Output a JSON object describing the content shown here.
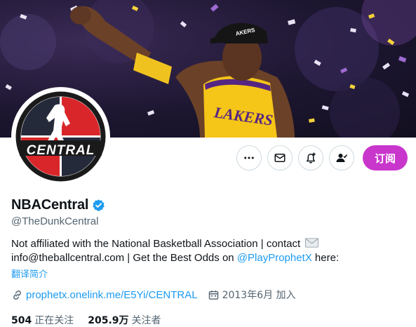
{
  "profile": {
    "display_name": "NBACentral",
    "handle": "@TheDunkCentral",
    "bio_line1": "Not affiliated with the National Basketball Association | contact",
    "bio_line2_pre": "info@theballcentral.com | Get the Best Odds on ",
    "bio_mention": "@PlayProphetX",
    "bio_line2_post": " here:",
    "translate_label": "翻译简介",
    "website": "prophetx.onelink.me/E5Yi/CENTRAL",
    "joined": "2013年6月 加入",
    "avatar_text": "CENTRAL"
  },
  "stats": {
    "following_count": "504",
    "following_label": "正在关注",
    "followers_count": "205.9万",
    "followers_label": "关注者"
  },
  "actions": {
    "subscribe_label": "订阅"
  },
  "icons": {
    "more": "more-icon",
    "message": "mail-icon",
    "notify": "bell-add-icon",
    "following": "person-check-icon",
    "verified": "verified-badge-icon",
    "link": "link-icon",
    "calendar": "calendar-icon"
  },
  "colors": {
    "accent": "#1d9bf0",
    "subscribe": "#c936cc",
    "text_secondary": "#536471",
    "jersey": "#f5c518",
    "lakers_purple": "#552583"
  }
}
